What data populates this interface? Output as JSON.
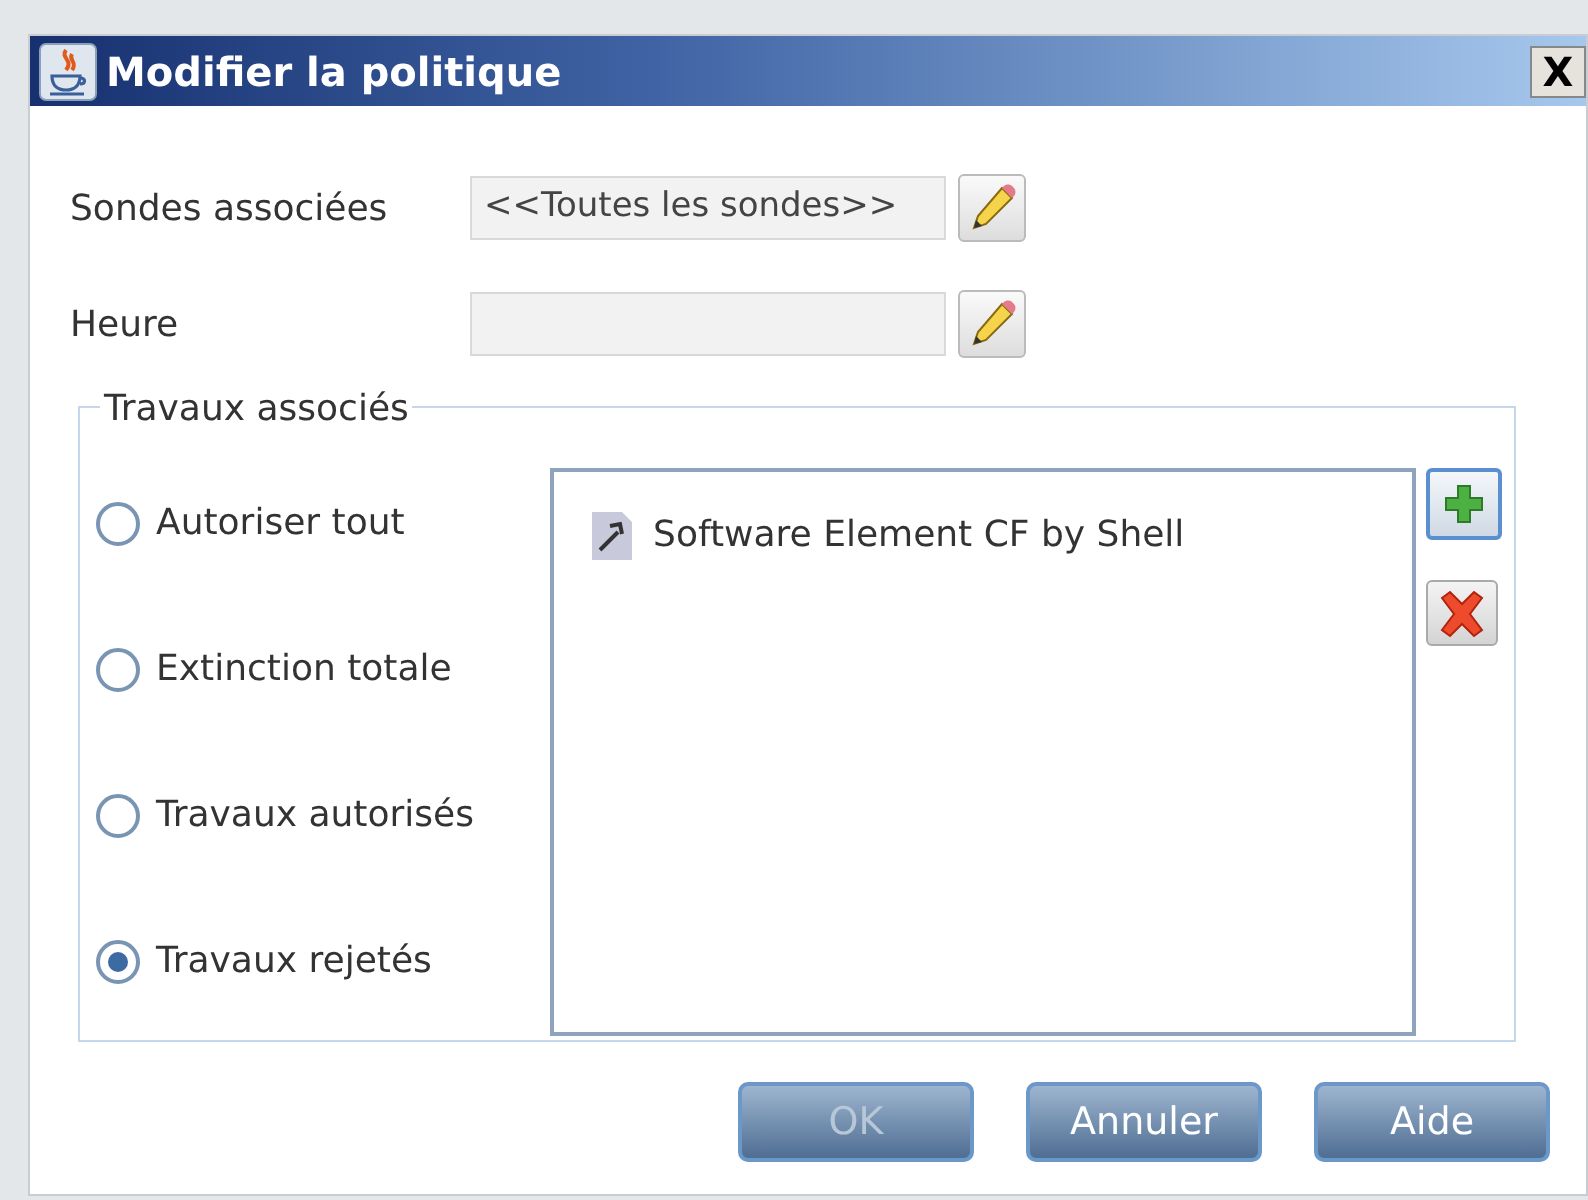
{
  "window": {
    "title": "Modifier la politique",
    "close": "X"
  },
  "fields": [
    {
      "label": "Sondes associées",
      "value": "<<Toutes les sondes>>"
    },
    {
      "label": "Heure"
    }
  ],
  "group": {
    "title": "Travaux associés",
    "options": [
      {
        "label": "Autoriser tout",
        "selected": false
      },
      {
        "label": "Extinction totale",
        "selected": false
      },
      {
        "label": "Travaux autorisés",
        "selected": false
      },
      {
        "label": "Travaux rejetés",
        "selected": true
      }
    ],
    "items": [
      {
        "label": "Software Element CF by Shell"
      }
    ]
  },
  "buttons": [
    {
      "label": "OK",
      "disabled": true
    },
    {
      "label": "Annuler",
      "disabled": false
    },
    {
      "label": "Aide",
      "disabled": false
    }
  ]
}
